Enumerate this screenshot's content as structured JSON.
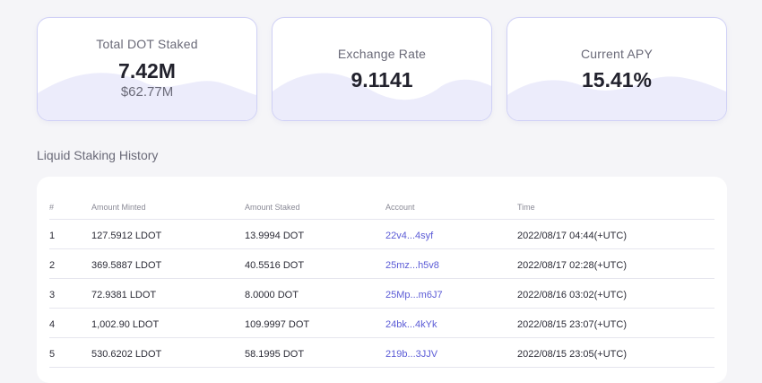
{
  "stats": {
    "total_staked": {
      "label": "Total DOT Staked",
      "value": "7.42M",
      "sub": "$62.77M"
    },
    "exchange_rate": {
      "label": "Exchange Rate",
      "value": "9.1141"
    },
    "apy": {
      "label": "Current APY",
      "value": "15.41%"
    },
    "wave_color": "#ececfb",
    "border_color": "#cfd0f6"
  },
  "history": {
    "title": "Liquid Staking History",
    "columns": [
      "#",
      "Amount Minted",
      "Amount Staked",
      "Account",
      "Time"
    ],
    "rows": [
      [
        "1",
        "127.5912 LDOT",
        "13.9994 DOT",
        "22v4...4syf",
        "2022/08/17 04:44(+UTC)"
      ],
      [
        "2",
        "369.5887 LDOT",
        "40.5516 DOT",
        "25mz...h5v8",
        "2022/08/17 02:28(+UTC)"
      ],
      [
        "3",
        "72.9381 LDOT",
        "8.0000 DOT",
        "25Mp...m6J7",
        "2022/08/16 03:02(+UTC)"
      ],
      [
        "4",
        "1,002.90 LDOT",
        "109.9997 DOT",
        "24bk...4kYk",
        "2022/08/15 23:07(+UTC)"
      ],
      [
        "5",
        "530.6202 LDOT",
        "58.1995 DOT",
        "219b...3JJV",
        "2022/08/15 23:05(+UTC)"
      ]
    ],
    "link_color": "#5b5bd6"
  }
}
